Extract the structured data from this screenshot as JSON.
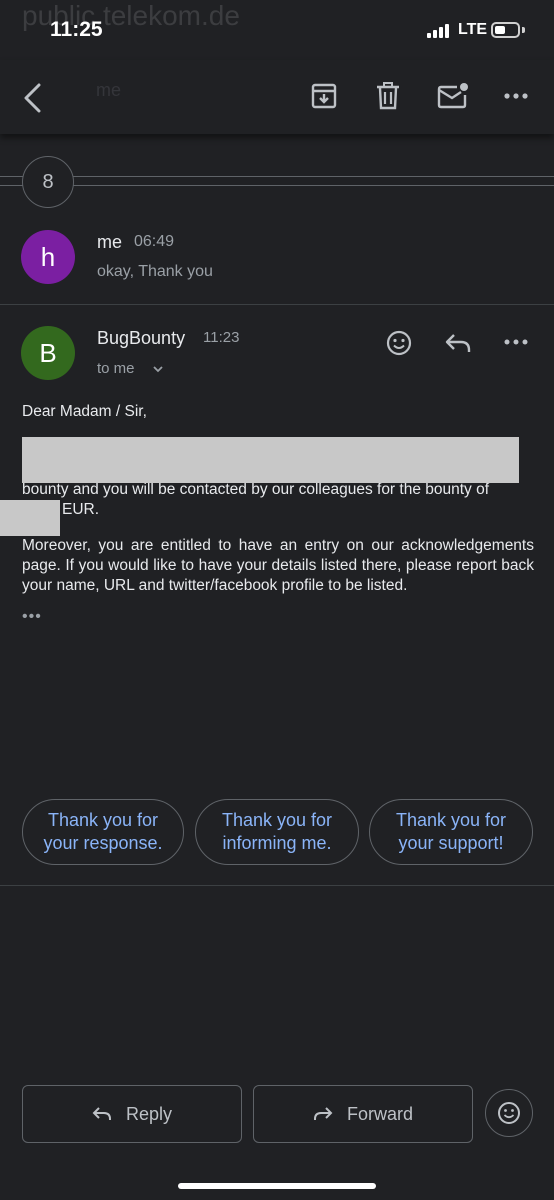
{
  "status_bar": {
    "time": "11:25",
    "network": "LTE",
    "faded_header_text": "public.telekom.de"
  },
  "app_bar": {
    "icons": [
      "back-arrow-icon",
      "archive-icon",
      "delete-icon",
      "mark-unread-icon",
      "more-vert-icon"
    ],
    "faded_sender": "me"
  },
  "collapsed": {
    "count": "8"
  },
  "messages": [
    {
      "avatar_letter": "h",
      "avatar_color": "#7b1fa2",
      "sender": "me",
      "time": "06:49",
      "snippet": "okay, Thank you"
    },
    {
      "avatar_letter": "B",
      "avatar_color": "#33691e",
      "sender": "BugBounty",
      "time": "11:23",
      "recipient": "to me",
      "greeting": "Dear Madam / Sir,",
      "body_line1_visible": "bounty and you will be contacted by our colleagues for the bounty of",
      "body_line2_visible": "EUR.",
      "paragraph2": "Moreover, you are entitled to have an entry on our acknowledgements page. If you would like to have your details listed there, please report back your name, URL and twitter/facebook profile to be listed.",
      "more": "•••"
    }
  ],
  "smart_replies": [
    {
      "line1": "Thank you for",
      "line2": "your response."
    },
    {
      "line1": "Thank you for",
      "line2": "informing me."
    },
    {
      "line1": "Thank you for",
      "line2": "your support!"
    }
  ],
  "actions": {
    "reply": "Reply",
    "forward": "Forward"
  },
  "colors": {
    "background": "#202124",
    "link": "#8ab4f8",
    "outline": "#5f6368"
  }
}
